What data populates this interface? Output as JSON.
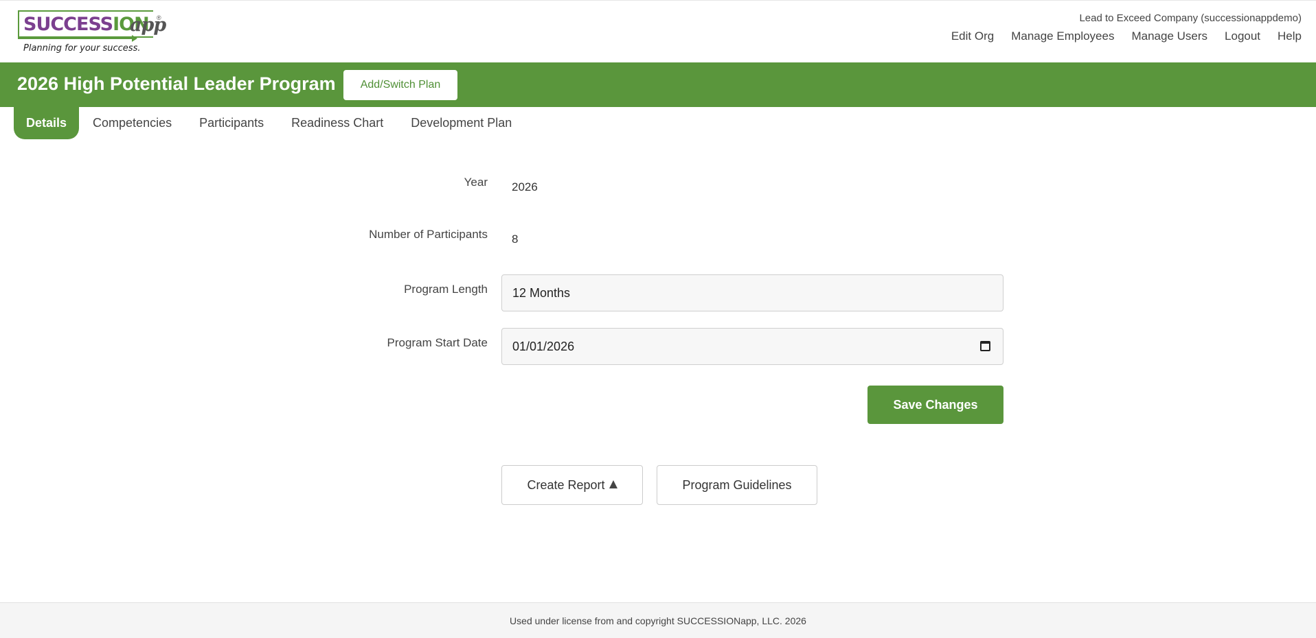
{
  "brand": {
    "logo_text_main": "SUCCESS",
    "logo_text_ion": "ION",
    "logo_text_app": "app",
    "logo_registered": "®",
    "tagline": "Planning for your success.",
    "colors": {
      "green": "#5a963c",
      "purple": "#7b3f8f"
    }
  },
  "header": {
    "company": "Lead to Exceed Company (successionappdemo)",
    "nav": [
      "Edit Org",
      "Manage Employees",
      "Manage Users",
      "Logout",
      "Help"
    ]
  },
  "plan": {
    "title": "2026 High Potential Leader Program",
    "switch_label": "Add/Switch Plan"
  },
  "tabs": [
    {
      "label": "Details",
      "active": true
    },
    {
      "label": "Competencies",
      "active": false
    },
    {
      "label": "Participants",
      "active": false
    },
    {
      "label": "Readiness Chart",
      "active": false
    },
    {
      "label": "Development Plan",
      "active": false
    }
  ],
  "form": {
    "year_label": "Year",
    "year_value": "2026",
    "participants_label": "Number of Participants",
    "participants_value": "8",
    "length_label": "Program Length",
    "length_value": "12 Months",
    "start_label": "Program Start Date",
    "start_value": "01/01/2026",
    "save_label": "Save Changes"
  },
  "actions": {
    "create_report_label": "Create Report",
    "guidelines_label": "Program Guidelines"
  },
  "footer": {
    "text": "Used under license from and copyright SUCCESSIONapp, LLC. 2026"
  }
}
